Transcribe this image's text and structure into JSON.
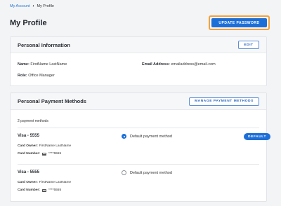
{
  "breadcrumb": {
    "parent": "My Account",
    "separator": "›",
    "current": "My Profile"
  },
  "page": {
    "title": "My Profile",
    "update_password_label": "UPDATE PASSWORD"
  },
  "personal_info": {
    "title": "Personal Information",
    "edit_label": "EDIT",
    "name_label": "Name:",
    "name_value": "FirstName LastName",
    "email_label": "Email Address:",
    "email_value": "emailaddress@email.com",
    "role_label": "Role:",
    "role_value": "Office Manager"
  },
  "payment_methods": {
    "title": "Personal Payment Methods",
    "manage_label": "MANAGE PAYMENT METHODS",
    "count_text": "2 payment methods",
    "default_radio_label": "Default payment method",
    "default_badge": "DEFAULT",
    "owner_label": "Card Owner:",
    "number_label": "Card Number:",
    "items": [
      {
        "name": "Visa - 5555",
        "owner": "FirstName LastName",
        "number": "****5555",
        "is_default": true
      },
      {
        "name": "Visa - 5555",
        "owner": "FirstName LastName",
        "number": "****5555",
        "is_default": false
      }
    ]
  },
  "colors": {
    "accent": "#1d6fd8",
    "focus_ring": "#f2a23b",
    "background": "#f3f4f6"
  }
}
